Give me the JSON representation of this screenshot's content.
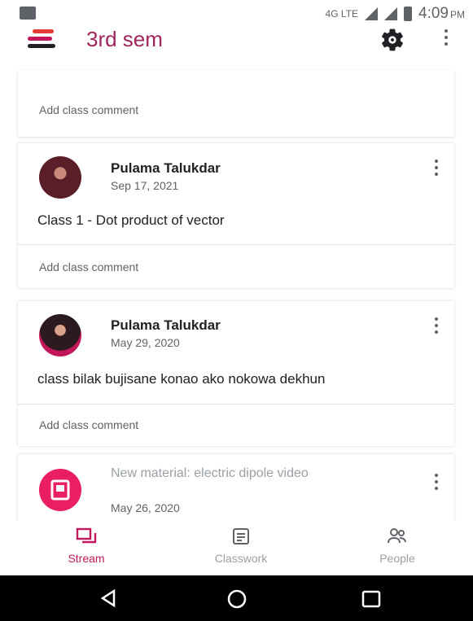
{
  "status_bar": {
    "network": "4G LTE",
    "time": "4:09",
    "ampm": "PM"
  },
  "app_bar": {
    "title": "3rd sem",
    "menu_icon": "stream-menu-icon",
    "settings_icon": "gear-icon",
    "overflow_icon": "more-vert-icon"
  },
  "stream": {
    "top_comment": "Add class comment",
    "posts": [
      {
        "author": "Pulama Talukdar",
        "date": "Sep 17, 2021",
        "text": "Class 1 - Dot product of vector",
        "comment": "Add class comment"
      },
      {
        "author": "Pulama Talukdar",
        "date": "May 29, 2020",
        "text": "class bilak bujisane konao ako nokowa dekhun",
        "comment": "Add class comment"
      },
      {
        "title": "New material: electric dipole video",
        "date": "May 26, 2020"
      }
    ]
  },
  "bottom_nav": {
    "items": [
      {
        "label": "Stream",
        "icon": "stream-icon",
        "active": true
      },
      {
        "label": "Classwork",
        "icon": "classwork-icon",
        "active": false
      },
      {
        "label": "People",
        "icon": "people-icon",
        "active": false
      }
    ]
  },
  "colors": {
    "accent": "#a1245c",
    "material_pink": "#e91e63",
    "nav_active": "#c2185b"
  }
}
